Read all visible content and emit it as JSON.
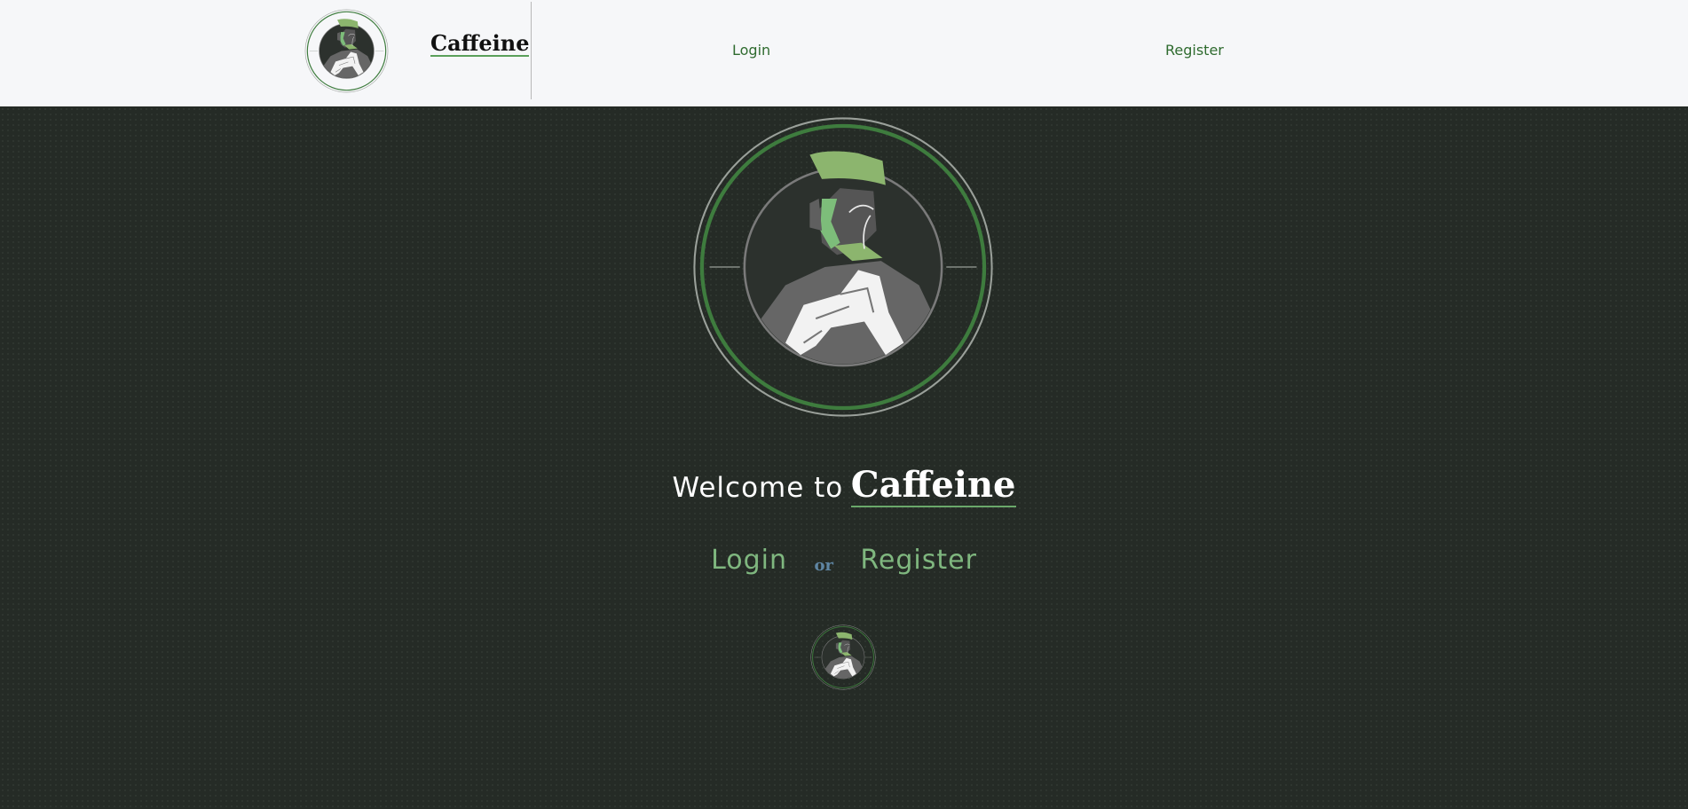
{
  "nav": {
    "brand": "Caffeine",
    "login": "Login",
    "register": "Register"
  },
  "hero": {
    "welcome_prefix": "Welcome to",
    "brand": "Caffeine",
    "login": "Login",
    "or": "or",
    "register": "Register"
  },
  "icons": {
    "logo": "caffeine-logo-icon"
  },
  "colors": {
    "nav_background": "#f6f7f9",
    "page_background": "#252b26",
    "accent_green": "#7fb77f",
    "ring_green": "#3e7c3e",
    "or_blue": "#5f86a3",
    "nav_link": "#2f6b2f"
  }
}
